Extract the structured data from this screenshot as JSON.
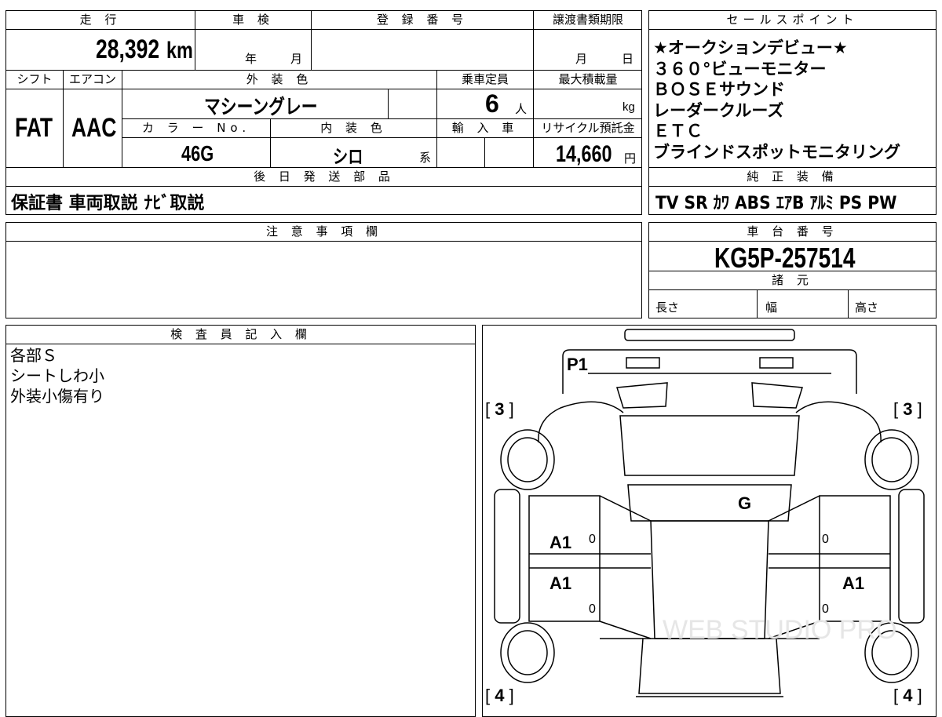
{
  "top": {
    "mileage_label": "走 行",
    "mileage_value": "28,392",
    "mileage_unit": "km",
    "shaken_label": "車 検",
    "shaken_year": "年",
    "shaken_month": "月",
    "reg_label": "登 録 番 号",
    "transfer_label": "譲渡書類期限",
    "transfer_month": "月",
    "transfer_day": "日",
    "shift_label": "シフト",
    "shift_value": "FAT",
    "ac_label": "エアコン",
    "ac_value": "AAC",
    "exterior_label": "外 装 色",
    "exterior_value": "マシーングレー",
    "capacity_label": "乗車定員",
    "capacity_value": "6",
    "capacity_unit": "人",
    "load_label": "最大積載量",
    "load_unit": "kg",
    "color_no_label": "カ ラ ー No.",
    "color_no_value": "46G",
    "interior_label": "内 装 色",
    "interior_value": "シロ",
    "interior_suffix": "系",
    "import_label": "輸 入 車",
    "recycle_label": "リサイクル預託金",
    "recycle_value": "14,660",
    "recycle_unit": "円",
    "later_label": "後 日 発 送 部 品",
    "later_value": "保証書 車両取説 ﾅﾋﾞ取説"
  },
  "sales_point": {
    "label": "セールスポイント",
    "lines": [
      "★オークションデビュー★",
      "３６０°ビューモニター",
      "ＢＯＳＥサウンド",
      "レーダークルーズ",
      "ＥＴＣ",
      "ブラインドスポットモニタリング"
    ]
  },
  "equipment": {
    "label": "純 正 装 備",
    "value": "TV SR ｶﾜ ABS ｴｱB ｱﾙﾐ PS PW"
  },
  "notice": {
    "label": "注 意 事 項 欄"
  },
  "chassis": {
    "label": "車 台 番 号",
    "value": "KG5P-257514",
    "specs_label": "諸 元",
    "length": "長さ",
    "width": "幅",
    "height": "高さ"
  },
  "inspector": {
    "label": "検 査 員 記 入 欄",
    "lines": [
      "各部Ｓ",
      "シートしわ小",
      "外装小傷有り"
    ]
  },
  "diagram": {
    "marks": {
      "p1": "P1",
      "g": "G",
      "a1_fl": "A1",
      "a1_rl": "A1",
      "a1_rr": "A1"
    },
    "zeros": [
      "0",
      "0",
      "0",
      "0"
    ],
    "brackets": {
      "fl": "3",
      "fr": "3",
      "rl": "4",
      "rr": "4"
    },
    "watermark": "WEB STUDIO PRO"
  }
}
